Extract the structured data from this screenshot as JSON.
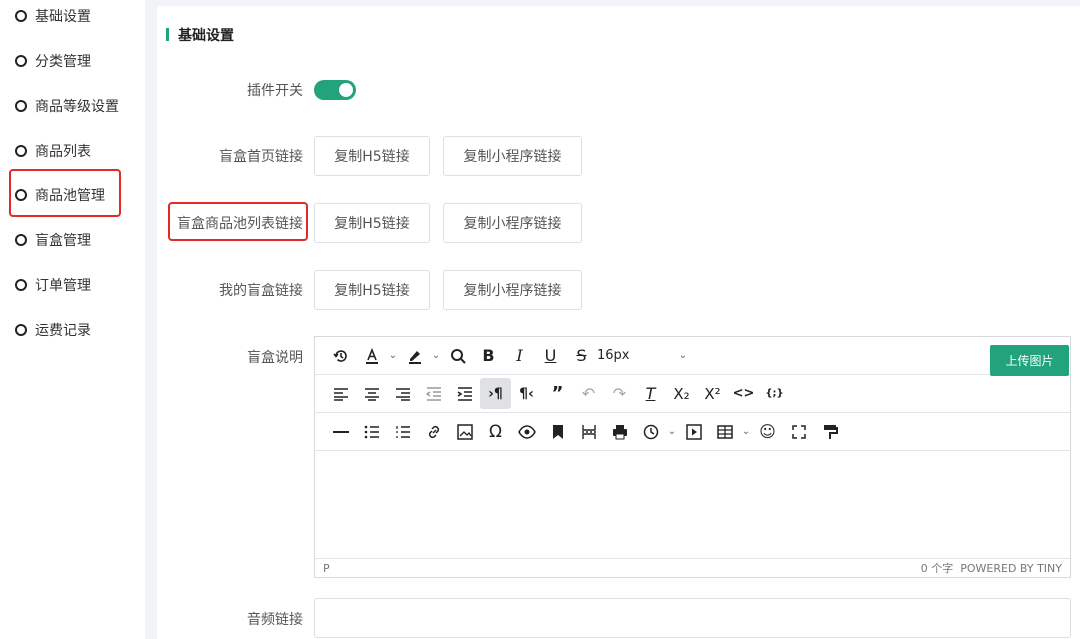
{
  "sidebar": {
    "items": [
      {
        "label": "基础设置"
      },
      {
        "label": "分类管理"
      },
      {
        "label": "商品等级设置"
      },
      {
        "label": "商品列表"
      },
      {
        "label": "商品池管理"
      },
      {
        "label": "盲盒管理"
      },
      {
        "label": "订单管理"
      },
      {
        "label": "运费记录"
      }
    ]
  },
  "section": {
    "title": "基础设置"
  },
  "form": {
    "plugin_switch": {
      "label": "插件开关",
      "enabled": true
    },
    "home_link": {
      "label": "盲盒首页链接",
      "h5_button": "复制H5链接",
      "mini_button": "复制小程序链接"
    },
    "pool_link": {
      "label": "盲盒商品池列表链接",
      "h5_button": "复制H5链接",
      "mini_button": "复制小程序链接"
    },
    "my_link": {
      "label": "我的盲盒链接",
      "h5_button": "复制H5链接",
      "mini_button": "复制小程序链接"
    },
    "description": {
      "label": "盲盒说明",
      "font_size": "16px",
      "upload_button": "上传图片",
      "status_path": "P",
      "word_count": "0 个字",
      "powered_by": "POWERED BY TINY",
      "content": ""
    },
    "audio": {
      "label": "音频链接",
      "value": ""
    }
  },
  "colors": {
    "accent": "#22a37c",
    "highlight": "#e02b2b"
  }
}
